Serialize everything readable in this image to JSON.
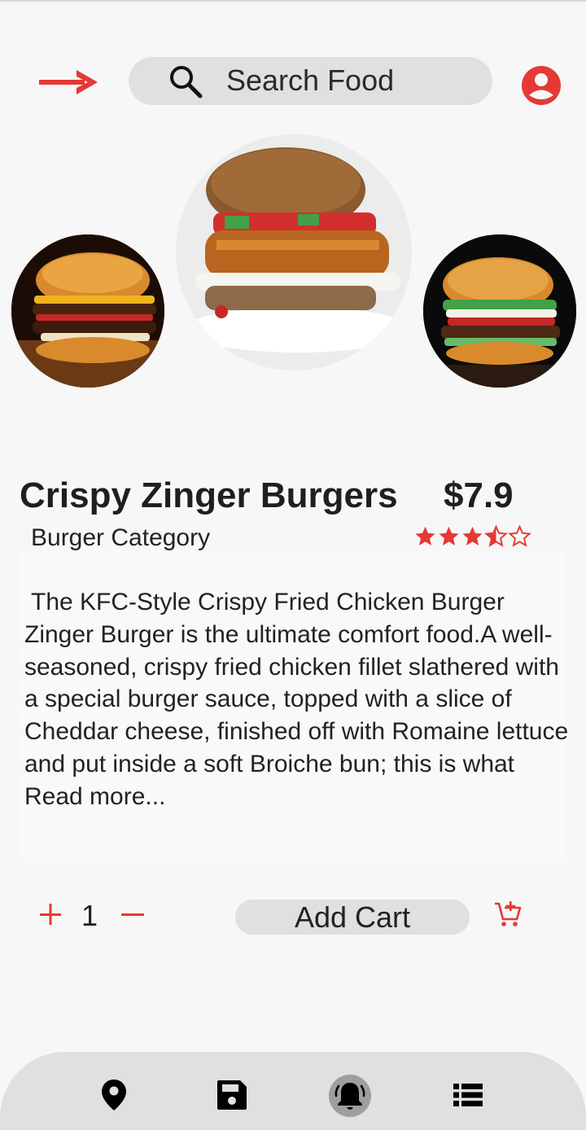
{
  "header": {
    "search_placeholder": "Search Food",
    "icons": {
      "back": "arrow-right-icon",
      "search": "search-icon",
      "profile": "account-circle-icon"
    }
  },
  "carousel": {
    "items": [
      {
        "name": "burger-image-left"
      },
      {
        "name": "burger-image-center"
      },
      {
        "name": "burger-image-right"
      }
    ]
  },
  "product": {
    "title": "Crispy Zinger Burgers",
    "price": "$7.9",
    "category": "Burger Category",
    "rating": 3.5,
    "rating_max": 5,
    "description_first": " The KFC-Style Crispy Fried Chicken Burger",
    "description_rest": "Zinger Burger is the ultimate comfort food.A well-seasoned, crispy fried chicken fillet slathered with a special burger sauce, topped with a slice of Cheddar cheese, finished off with Romaine lettuce and put inside a soft Broiche bun; this is what",
    "read_more": "Read more..."
  },
  "order": {
    "plus": "+",
    "quantity": "1",
    "add_cart_label": "Add Cart"
  },
  "bottom_nav": {
    "items": [
      "location-icon",
      "save-icon",
      "notification-bell-icon",
      "list-icon"
    ]
  },
  "colors": {
    "accent": "#e53935",
    "background": "#f7f7f7",
    "pill": "#e0e0e0",
    "text": "#1e1e1e"
  }
}
